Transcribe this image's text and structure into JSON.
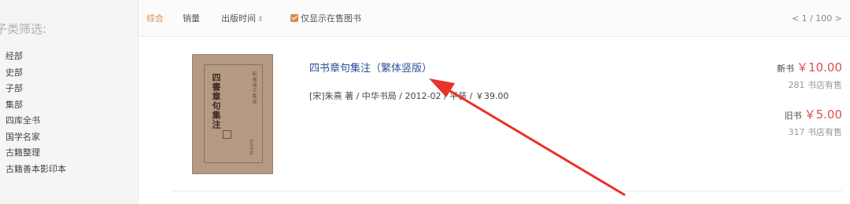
{
  "sidebar": {
    "title": "子类筛选:",
    "items": [
      {
        "label": "经部"
      },
      {
        "label": "史部"
      },
      {
        "label": "子部"
      },
      {
        "label": "集部"
      },
      {
        "label": "四库全书"
      },
      {
        "label": "国学名家"
      },
      {
        "label": "古籍整理"
      },
      {
        "label": "古籍善本影印本"
      }
    ]
  },
  "toolbar": {
    "sort_overall": "综合",
    "sort_sales": "销量",
    "sort_pubdate": "出版时间",
    "sort_icon": "updown-arrow-icon",
    "only_in_stock_label": "仅显示在售图书",
    "only_in_stock_checked": true,
    "pager": "< 1 / 100 >",
    "accent_color": "#d98c4b"
  },
  "book": {
    "title": "四书章句集注（繁体竖版）",
    "meta": "[宋]朱熹 著 / 中华书局 / 2012-02 / 平装 / ￥39.00",
    "cover": {
      "title": "四書章句集注",
      "series": "新编诸子集成",
      "publisher": "中华书局"
    },
    "new_label": "新书",
    "new_price": "￥10.00",
    "new_stock": "281 书店有售",
    "used_label": "旧书",
    "used_price": "￥5.00",
    "used_stock": "317 书店有售",
    "price_color": "#d9534f"
  },
  "annotation": {
    "color": "#e8322a",
    "icon": "red-arrow-icon"
  }
}
